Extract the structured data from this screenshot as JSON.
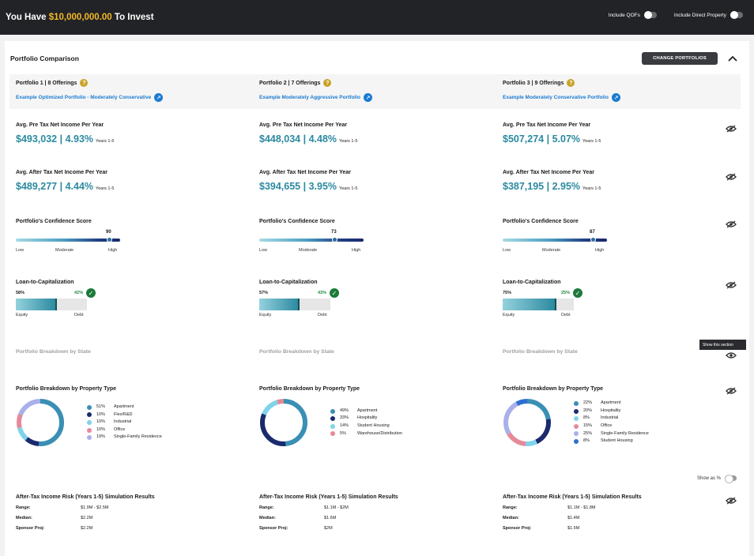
{
  "header": {
    "title_prefix": "You Have ",
    "amount": "$10,000,000.00",
    "title_suffix": " To Invest",
    "toggle_qofs": "Include QOFs",
    "toggle_direct": "Include Direct Property"
  },
  "panel": {
    "title": "Portfolio Comparison",
    "change_button": "CHANGE PORTFOLIOS",
    "tooltip": "Show this section",
    "show_as_pct": "Show as %"
  },
  "labels": {
    "pre_tax": "Avg. Pre Tax Net Income Per Year",
    "after_tax": "Avg. After Tax Net Income Per Year",
    "years": "Years 1-5",
    "confidence": "Portfolio's Confidence Score",
    "low": "Low",
    "moderate": "Moderate",
    "high": "High",
    "ltc": "Loan-to-Capitalization",
    "equity": "Equity",
    "debt": "Debt",
    "by_state": "Portfolio Breakdown by State",
    "by_type": "Portfolio Breakdown by Property Type",
    "sim": "After-Tax Income Risk (Years 1-5) Simulation Results",
    "range": "Range:",
    "median": "Median:",
    "sponsor": "Sponsor Proj:"
  },
  "portfolios": [
    {
      "name": "Portfolio 1  |  8 Offerings",
      "link": "Example Optimized Portfolio - Moderately Conservative",
      "pre_tax": "$493,032 | 4.93%",
      "after_tax": "$489,277 | 4.44%",
      "confidence": 90,
      "equity_pct": "58%",
      "debt_pct": "42%",
      "equity": 58,
      "types": [
        {
          "pct": "51%",
          "label": "Apartment",
          "value": 51,
          "color": "#3a8fb5"
        },
        {
          "pct": "10%",
          "label": "Flex/R&D",
          "value": 10,
          "color": "#1a2a6c"
        },
        {
          "pct": "10%",
          "label": "Industrial",
          "value": 10,
          "color": "#7fd3ea"
        },
        {
          "pct": "10%",
          "label": "Office",
          "value": 10,
          "color": "#e58a9a"
        },
        {
          "pct": "19%",
          "label": "Single-Family Residence",
          "value": 19,
          "color": "#a9b0ea"
        }
      ],
      "range": "$1.9M - $2.5M",
      "median": "$2.2M",
      "sponsor": "$2.2M"
    },
    {
      "name": "Portfolio 2  |  7 Offerings",
      "link": "Example Moderately Aggressive Portfolio",
      "pre_tax": "$448,034 | 4.48%",
      "after_tax": "$394,655 | 3.95%",
      "confidence": 73,
      "equity_pct": "57%",
      "debt_pct": "43%",
      "equity": 57,
      "types": [
        {
          "pct": "49%",
          "label": "Apartment",
          "value": 49,
          "color": "#3a8fb5"
        },
        {
          "pct": "33%",
          "label": "Hospitality",
          "value": 33,
          "color": "#1a2a6c"
        },
        {
          "pct": "14%",
          "label": "Student Housing",
          "value": 14,
          "color": "#7fd3ea"
        },
        {
          "pct": "5%",
          "label": "Warehouse/Distribution",
          "value": 5,
          "color": "#e58a9a"
        }
      ],
      "range": "$1.1M - $2M",
      "median": "$1.6M",
      "sponsor": "$2M"
    },
    {
      "name": "Portfolio 3  |  9 Offerings",
      "link": "Example Moderately Conservative Portfolio",
      "pre_tax": "$507,274 | 5.07%",
      "after_tax": "$387,195 | 2.95%",
      "confidence": 87,
      "equity_pct": "75%",
      "debt_pct": "25%",
      "equity": 75,
      "types": [
        {
          "pct": "22%",
          "label": "Apartment",
          "value": 22,
          "color": "#3a8fb5"
        },
        {
          "pct": "20%",
          "label": "Hospitality",
          "value": 20,
          "color": "#1a2a6c"
        },
        {
          "pct": "8%",
          "label": "Industrial",
          "value": 8,
          "color": "#7fd3ea"
        },
        {
          "pct": "15%",
          "label": "Office",
          "value": 15,
          "color": "#e58a9a"
        },
        {
          "pct": "25%",
          "label": "Single-Family Residence",
          "value": 25,
          "color": "#a9b0ea"
        },
        {
          "pct": "8%",
          "label": "Student Housing",
          "value": 8,
          "color": "#2f6fd0"
        }
      ],
      "range": "$1.1M - $1.8M",
      "median": "$1.4M",
      "sponsor": "$1.5M"
    }
  ]
}
